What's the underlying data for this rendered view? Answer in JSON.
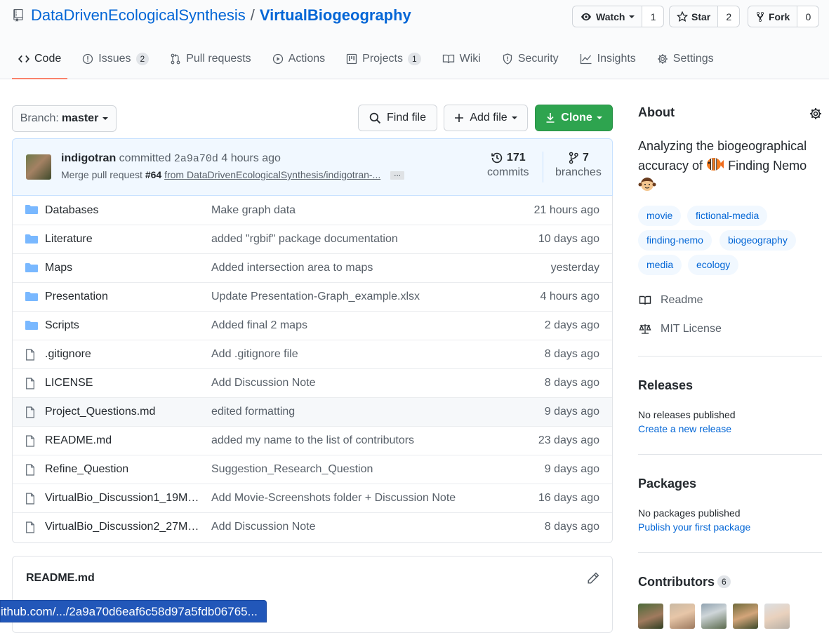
{
  "header": {
    "owner": "DataDrivenEcologicalSynthesis",
    "separator": "/",
    "repo": "VirtualBiogeography",
    "watch": {
      "label": "Watch",
      "count": "1"
    },
    "star": {
      "label": "Star",
      "count": "2"
    },
    "fork": {
      "label": "Fork",
      "count": "0"
    }
  },
  "tabs": [
    {
      "label": "Code",
      "icon": "code-icon",
      "selected": true
    },
    {
      "label": "Issues",
      "icon": "issue-opened-icon",
      "counter": "2"
    },
    {
      "label": "Pull requests",
      "icon": "git-pull-request-icon"
    },
    {
      "label": "Actions",
      "icon": "play-icon"
    },
    {
      "label": "Projects",
      "icon": "project-icon",
      "counter": "1"
    },
    {
      "label": "Wiki",
      "icon": "book-icon"
    },
    {
      "label": "Security",
      "icon": "shield-icon"
    },
    {
      "label": "Insights",
      "icon": "graph-icon"
    },
    {
      "label": "Settings",
      "icon": "gear-icon"
    }
  ],
  "toolbar": {
    "branch_prefix": "Branch:",
    "branch_name": "master",
    "find_file": "Find file",
    "add_file": "Add file",
    "clone": "Clone"
  },
  "commit": {
    "author": "indigotran",
    "verb": "committed",
    "sha": "2a9a70d",
    "time": "4 hours ago",
    "message_prefix": "Merge pull request",
    "pr_number": "#64",
    "message_link": "from DataDrivenEcologicalSynthesis/indigotran-...",
    "ellipsis": "...",
    "commits_count": "171",
    "commits_label": "commits",
    "branches_count": "7",
    "branches_label": "branches"
  },
  "files": [
    {
      "type": "folder",
      "name": "Databases",
      "message": "Make graph data",
      "age": "21 hours ago"
    },
    {
      "type": "folder",
      "name": "Literature",
      "message": "added \"rgbif\" package documentation",
      "age": "10 days ago"
    },
    {
      "type": "folder",
      "name": "Maps",
      "message": "Added intersection area to maps",
      "age": "yesterday"
    },
    {
      "type": "folder",
      "name": "Presentation",
      "message": "Update Presentation-Graph_example.xlsx",
      "age": "4 hours ago"
    },
    {
      "type": "folder",
      "name": "Scripts",
      "message": "Added final 2 maps",
      "age": "2 days ago"
    },
    {
      "type": "file",
      "name": ".gitignore",
      "message": "Add .gitignore file",
      "age": "8 days ago"
    },
    {
      "type": "file",
      "name": "LICENSE",
      "message": "Add Discussion Note",
      "age": "8 days ago"
    },
    {
      "type": "file",
      "name": "Project_Questions.md",
      "message": "edited formatting",
      "age": "9 days ago"
    },
    {
      "type": "file",
      "name": "README.md",
      "message": "added my name to the list of contributors",
      "age": "23 days ago"
    },
    {
      "type": "file",
      "name": "Refine_Question",
      "message": "Suggestion_Research_Question",
      "age": "9 days ago"
    },
    {
      "type": "file",
      "name": "VirtualBio_Discussion1_19Ma...",
      "message": "Add Movie-Screenshots folder + Discussion Note",
      "age": "16 days ago"
    },
    {
      "type": "file",
      "name": "VirtualBio_Discussion2_27Ma...",
      "message": "Add Discussion Note",
      "age": "8 days ago"
    }
  ],
  "readme": {
    "title": "README.md"
  },
  "status_bar": {
    "url": "ithub.com/.../2a9a70d6eaf6c58d97a5fdb06765..."
  },
  "about": {
    "title": "About",
    "desc_part1": "Analyzing the biogeographical accuracy of",
    "desc_part2": "Finding Nemo",
    "topics": [
      "movie",
      "fictional-media",
      "finding-nemo",
      "biogeography",
      "media",
      "ecology"
    ],
    "readme_link": "Readme",
    "license_link": "MIT License"
  },
  "releases": {
    "title": "Releases",
    "none": "No releases published",
    "create": "Create a new release"
  },
  "packages": {
    "title": "Packages",
    "none": "No packages published",
    "publish": "Publish your first package"
  },
  "contributors": {
    "title": "Contributors",
    "count": "6"
  },
  "colors": {
    "link": "#0366d6",
    "green_button": "#2ea44f",
    "tab_underline": "#f9826c",
    "status_bar": "#2257b9"
  }
}
